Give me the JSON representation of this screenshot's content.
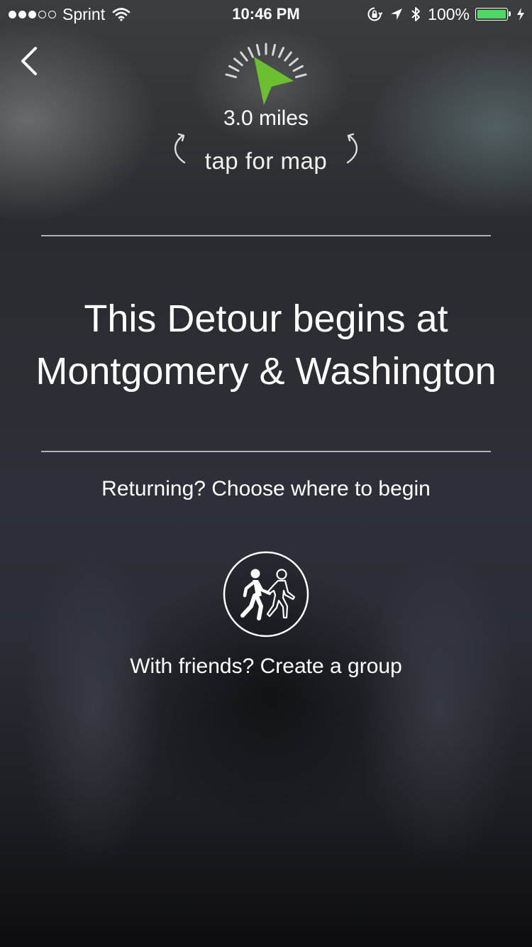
{
  "status_bar": {
    "carrier": "Sprint",
    "signal_filled": 3,
    "signal_total": 5,
    "time": "10:46 PM",
    "battery_percent": "100%",
    "battery_color": "#4cd964",
    "icons": [
      "wifi-icon",
      "orientation-lock-icon",
      "location-arrow-icon",
      "bluetooth-icon",
      "charging-bolt-icon"
    ]
  },
  "nav": {
    "back_icon": "chevron-left-icon"
  },
  "compass": {
    "arrow_color": "#6cbf2f",
    "distance": "3.0 miles",
    "tap_label": "tap for map"
  },
  "headline": {
    "line1": "This Detour begins at",
    "line2": "Montgomery & Washington"
  },
  "actions": {
    "returning_label": "Returning? Choose where to begin",
    "group_icon": "walking-friends-icon",
    "group_label": "With friends? Create a group"
  }
}
